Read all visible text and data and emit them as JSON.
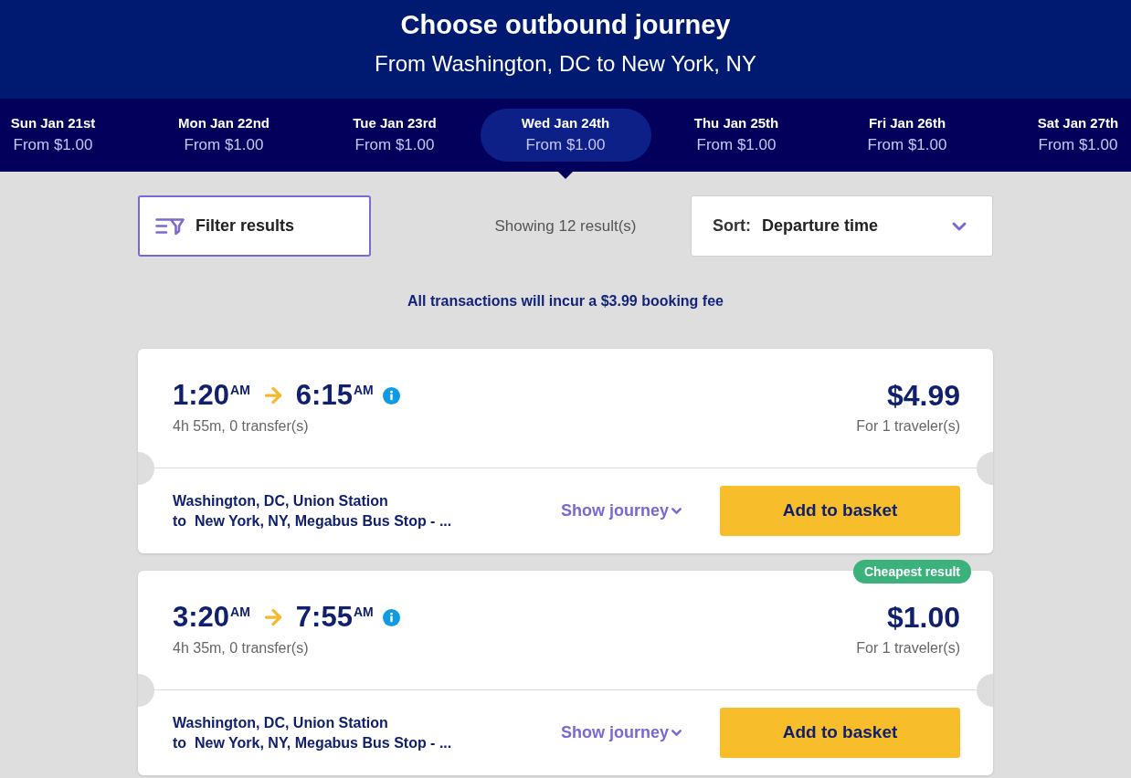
{
  "header": {
    "title": "Choose outbound journey",
    "subtitle": "From Washington, DC to New York, NY"
  },
  "dates": [
    {
      "day": "Sun Jan 21st",
      "price": "From $1.00",
      "selected": false
    },
    {
      "day": "Mon Jan 22nd",
      "price": "From $1.00",
      "selected": false
    },
    {
      "day": "Tue Jan 23rd",
      "price": "From $1.00",
      "selected": false
    },
    {
      "day": "Wed Jan 24th",
      "price": "From $1.00",
      "selected": true
    },
    {
      "day": "Thu Jan 25th",
      "price": "From $1.00",
      "selected": false
    },
    {
      "day": "Fri Jan 26th",
      "price": "From $1.00",
      "selected": false
    },
    {
      "day": "Sat Jan 27th",
      "price": "From $1.00",
      "selected": false
    }
  ],
  "toolbar": {
    "filter_button": "Filter results",
    "results_count": "Showing 12 result(s)",
    "sort": {
      "label": "Sort:",
      "value": "Departure time"
    }
  },
  "notice": "All transactions will incur a $3.99 booking fee",
  "journeys": [
    {
      "departure": {
        "time": "1:20",
        "period": "AM"
      },
      "arrival": {
        "time": "6:15",
        "period": "AM"
      },
      "duration": "4h 55m, 0 transfer(s)",
      "price": "$4.99",
      "travelers": "For 1 traveler(s)",
      "origin": "Washington, DC, Union Station",
      "destination": "to  New York, NY, Megabus Bus Stop - ...",
      "show_journey": "Show journey",
      "add_button": "Add to basket"
    },
    {
      "badge": "Cheapest result",
      "departure": {
        "time": "3:20",
        "period": "AM"
      },
      "arrival": {
        "time": "7:55",
        "period": "AM"
      },
      "duration": "4h 35m, 0 transfer(s)",
      "price": "$1.00",
      "travelers": "For 1 traveler(s)",
      "origin": "Washington, DC, Union Station",
      "destination": "to  New York, NY, Megabus Bus Stop - ...",
      "show_journey": "Show journey",
      "add_button": "Add to basket"
    }
  ]
}
